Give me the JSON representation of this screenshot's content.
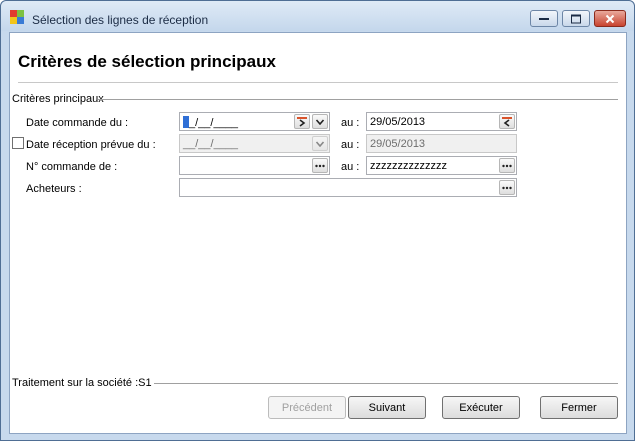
{
  "window": {
    "title": "Sélection des lignes de réception",
    "icon_colors": [
      "#e23b2e",
      "#7cc142",
      "#f2c51b",
      "#3a7bd5"
    ]
  },
  "heading": "Critères de sélection principaux",
  "criteria": {
    "group_label": "Critères principaux",
    "date_commande": {
      "label": "Date commande du :",
      "from": "_/__/____",
      "to_label": "au :",
      "to": "29/05/2013"
    },
    "date_reception": {
      "label": "Date réception prévue du :",
      "checked": false,
      "from": "__/__/____",
      "to_label": "au :",
      "to": "29/05/2013"
    },
    "num_commande": {
      "label": "N° commande de :",
      "from": "",
      "to_label": "au :",
      "to": "zzzzzzzzzzzzzz"
    },
    "acheteurs": {
      "label": "Acheteurs :",
      "value": ""
    }
  },
  "footer": {
    "societe": "Traitement sur la société :S1"
  },
  "buttons": {
    "precedent": "Précédent",
    "suivant": "Suivant",
    "executer": "Exécuter",
    "fermer": "Fermer"
  }
}
